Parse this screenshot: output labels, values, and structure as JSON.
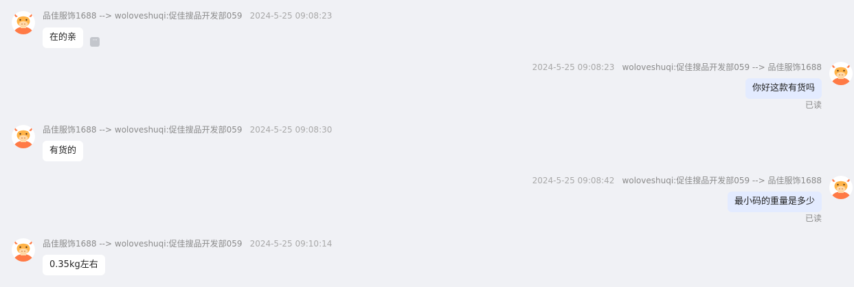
{
  "messages": [
    {
      "side": "left",
      "sender": "品佳服饰1688 --> woloveshuqi:促佳搜品开发部059",
      "time": "2024-5-25 09:08:23",
      "text": "在的亲",
      "has_more": true,
      "more_glyph": "···",
      "read": ""
    },
    {
      "side": "right",
      "sender": "woloveshuqi:促佳搜品开发部059 --> 品佳服饰1688",
      "time": "2024-5-25 09:08:23",
      "text": "你好这款有货吗",
      "read": "已读"
    },
    {
      "side": "left",
      "sender": "品佳服饰1688 --> woloveshuqi:促佳搜品开发部059",
      "time": "2024-5-25 09:08:30",
      "text": "有货的",
      "read": ""
    },
    {
      "side": "right",
      "sender": "woloveshuqi:促佳搜品开发部059 --> 品佳服饰1688",
      "time": "2024-5-25 09:08:42",
      "text": "最小码的重量是多少",
      "read": "已读"
    },
    {
      "side": "left",
      "sender": "品佳服饰1688 --> woloveshuqi:促佳搜品开发部059",
      "time": "2024-5-25 09:10:14",
      "text": "0.35kg左右",
      "read": ""
    }
  ],
  "icons": {
    "avatar": "cow-avatar-icon",
    "more": "more-icon"
  },
  "colors": {
    "background": "#f0f1f5",
    "incoming_bubble": "#ffffff",
    "outgoing_bubble": "#e3ebff",
    "avatar_orange": "#ff7a45"
  }
}
